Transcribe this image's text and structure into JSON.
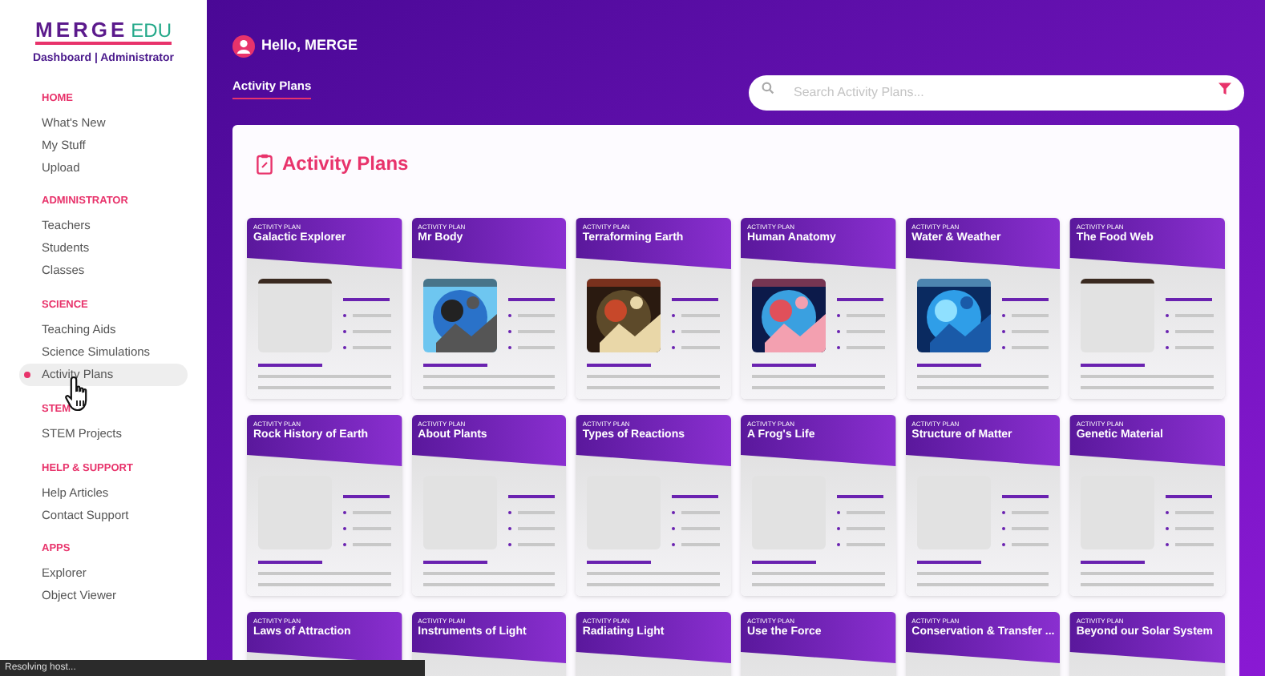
{
  "logo": {
    "brand": "MERGE",
    "suffix": "EDU",
    "subtitle": "Dashboard | Administrator"
  },
  "sidebar": {
    "sections": [
      {
        "title": "HOME",
        "items": [
          {
            "label": "What's New",
            "selected": false
          },
          {
            "label": "My Stuff",
            "selected": false
          },
          {
            "label": "Upload",
            "selected": false
          }
        ]
      },
      {
        "title": "ADMINISTRATOR",
        "items": [
          {
            "label": "Teachers",
            "selected": false
          },
          {
            "label": "Students",
            "selected": false
          },
          {
            "label": "Classes",
            "selected": false
          }
        ]
      },
      {
        "title": "SCIENCE",
        "items": [
          {
            "label": "Teaching Aids",
            "selected": false
          },
          {
            "label": "Science Simulations",
            "selected": false
          },
          {
            "label": "Activity Plans",
            "selected": true
          }
        ]
      },
      {
        "title": "STEM",
        "items": [
          {
            "label": "STEM Projects",
            "selected": false
          }
        ]
      },
      {
        "title": "HELP & SUPPORT",
        "items": [
          {
            "label": "Help Articles",
            "selected": false
          },
          {
            "label": "Contact Support",
            "selected": false
          }
        ]
      },
      {
        "title": "APPS",
        "items": [
          {
            "label": "Explorer",
            "selected": false
          },
          {
            "label": "Object Viewer",
            "selected": false
          }
        ]
      }
    ]
  },
  "header": {
    "greeting": "Hello, MERGE",
    "tabs": [
      {
        "label": "Activity Plans",
        "selected": true
      }
    ],
    "search": {
      "placeholder": "Search Activity Plans..."
    }
  },
  "panel": {
    "title": "Activity Plans",
    "cards": [
      {
        "label": "ACTIVITY PLAN",
        "title": "Galactic Explorer",
        "kind": "loading"
      },
      {
        "label": "ACTIVITY PLAN",
        "title": "Mr Body",
        "kind": "picture"
      },
      {
        "label": "ACTIVITY PLAN",
        "title": "Terraforming Earth",
        "kind": "picture"
      },
      {
        "label": "ACTIVITY PLAN",
        "title": "Human Anatomy",
        "kind": "picture"
      },
      {
        "label": "ACTIVITY PLAN",
        "title": "Water & Weather",
        "kind": "picture"
      },
      {
        "label": "ACTIVITY PLAN",
        "title": "The Food Web",
        "kind": "loading"
      },
      {
        "label": "ACTIVITY PLAN",
        "title": "Rock History of Earth",
        "kind": "placeholder"
      },
      {
        "label": "ACTIVITY PLAN",
        "title": "About Plants",
        "kind": "placeholder"
      },
      {
        "label": "ACTIVITY PLAN",
        "title": "Types of Reactions",
        "kind": "placeholder"
      },
      {
        "label": "ACTIVITY PLAN",
        "title": "A Frog's Life",
        "kind": "placeholder"
      },
      {
        "label": "ACTIVITY PLAN",
        "title": "Structure of Matter",
        "kind": "placeholder"
      },
      {
        "label": "ACTIVITY PLAN",
        "title": "Genetic Material",
        "kind": "placeholder"
      },
      {
        "label": "ACTIVITY PLAN",
        "title": "Laws of Attraction"
      },
      {
        "label": "ACTIVITY PLAN",
        "title": "Instruments of Light"
      },
      {
        "label": "ACTIVITY PLAN",
        "title": "Radiating Light"
      },
      {
        "label": "ACTIVITY PLAN",
        "title": "Use the Force"
      },
      {
        "label": "ACTIVITY PLAN",
        "title": "Conservation & Transfer ..."
      },
      {
        "label": "ACTIVITY PLAN",
        "title": "Beyond our Solar System"
      }
    ]
  },
  "status_bar": {
    "text": "Resolving host..."
  }
}
